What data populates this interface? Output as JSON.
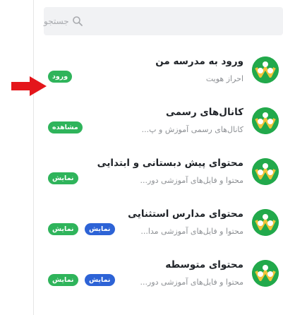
{
  "search": {
    "placeholder": "جستجو"
  },
  "items": [
    {
      "title": "ورود به مدرسه من",
      "subtitle": "احراز هویت",
      "badges": [
        "ورود"
      ]
    },
    {
      "title": "کانال‌های رسمی",
      "subtitle": "کانال‌های رسمی آموزش و پ...",
      "badges": [
        "مشاهده"
      ]
    },
    {
      "title": "محتوای پیش دبستانی و ابتدایی",
      "subtitle": "محتوا و فایل‌های آموزشی دور...",
      "badges": [
        "نمایش"
      ]
    },
    {
      "title": "محتوای مدارس استثنایی",
      "subtitle": "محتوا و فایل‌های آموزشی مدا...",
      "badges": [
        "نمایش",
        "نمایش"
      ]
    },
    {
      "title": "محتوای متوسطه",
      "subtitle": "محتوا و فایل‌های آموزشی دور...",
      "badges": [
        "نمایش",
        "نمایش"
      ]
    }
  ],
  "colors": {
    "accent_green": "#2fb45b",
    "badge_blue": "#2d63d6",
    "arrow_red": "#e4161b"
  }
}
